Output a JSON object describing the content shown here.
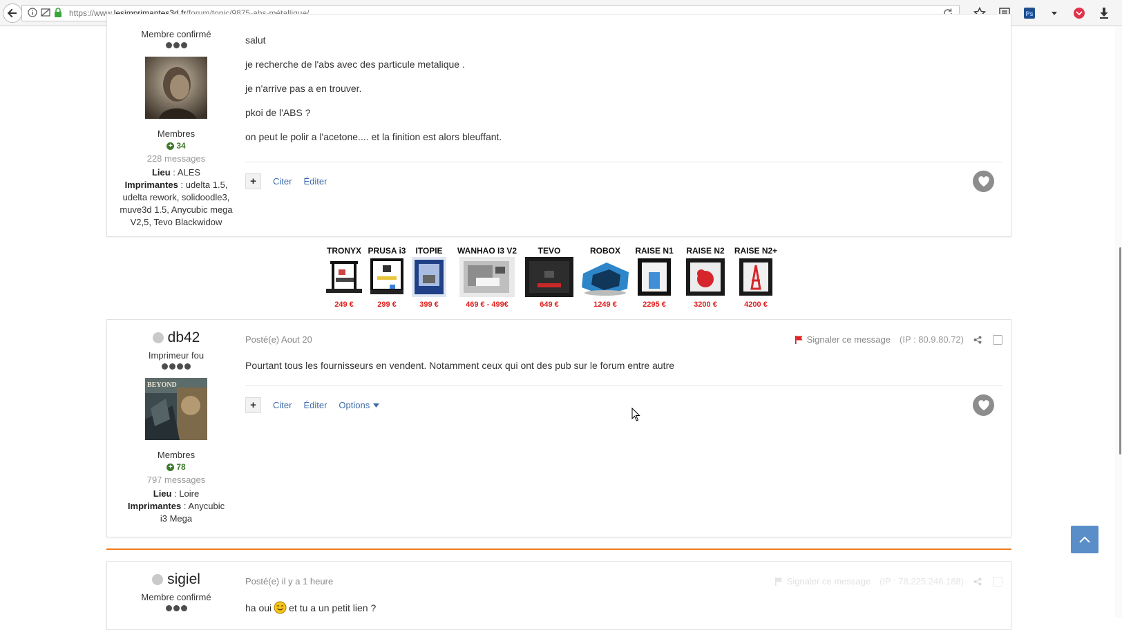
{
  "browser": {
    "url_prefix": "https://www.",
    "url_domain": "lesimprimantes3d.fr",
    "url_path": "/forum/topic/9875-abs-métallique/"
  },
  "post1": {
    "author": {
      "rank": "Membre confirmé",
      "group": "Membres",
      "reputation": "34",
      "messages": "228 messages",
      "location_label": "Lieu",
      "location_value": " : ALES",
      "printers_label": "Imprimantes",
      "printers_value": " : udelta 1.5, udelta rework, solidoodle3, muve3d 1.5, Anycubic mega V2,5, Tevo Blackwidow"
    },
    "paragraphs": [
      "salut",
      "je recherche de l'abs avec des particule metalique .",
      "je n'arrive pas a en trouver.",
      "pkoi de l'ABS ?",
      "on peut le polir a l'acetone.... et la finition est alors bleuffant."
    ],
    "actions": {
      "quote": "Citer",
      "edit": "Éditer"
    }
  },
  "ad_banner": {
    "items": [
      {
        "name": "TRONYX",
        "price": "249 €"
      },
      {
        "name": "PRUSA i3",
        "price": "299 €"
      },
      {
        "name": "ITOPIE",
        "price": "399 €"
      },
      {
        "name": "WANHAO I3 V2",
        "price": "469 € - 499€"
      },
      {
        "name": "TEVO",
        "price": "649 €"
      },
      {
        "name": "ROBOX",
        "price": "1249 €"
      },
      {
        "name": "RAISE N1",
        "price": "2295 €"
      },
      {
        "name": "RAISE N2",
        "price": "3200 €"
      },
      {
        "name": "RAISE N2+",
        "price": "4200 €"
      }
    ]
  },
  "post2": {
    "author": {
      "name": "db42",
      "rank": "Imprimeur fou",
      "group": "Membres",
      "reputation": "78",
      "messages": "797 messages",
      "location_label": "Lieu",
      "location_value": " : Loire",
      "printers_label": "Imprimantes",
      "printers_value": " : Anycubic i3 Mega"
    },
    "posted": "Posté(e) Aout 20",
    "report": "Signaler ce message",
    "ip": "(IP : 80.9.80.72)",
    "body": "Pourtant tous les fournisseurs en vendent. Notamment ceux qui ont des pub sur le forum entre autre",
    "actions": {
      "quote": "Citer",
      "edit": "Éditer",
      "options": "Options"
    }
  },
  "post3": {
    "author": {
      "name": "sigiel",
      "rank": "Membre confirmé"
    },
    "posted": "Posté(e) il y a 1 heure",
    "report": "Signaler ce message",
    "ip": "(IP : 78.225.246.188)",
    "body_before": "ha oui ",
    "body_after": " et tu a un petit lien ?"
  },
  "colors": {
    "link": "#3c6aa8",
    "accent_orange": "#ee7d1c",
    "price_red": "#e21f1f",
    "reputation_green": "#3d7a2d",
    "scroll_top_button": "#5a8ec8"
  }
}
